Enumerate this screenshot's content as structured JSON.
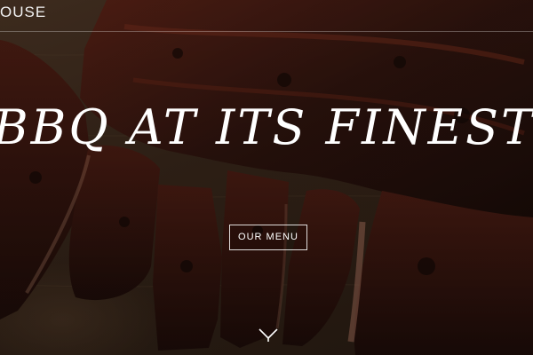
{
  "brand": {
    "name_fragment": "OUSE"
  },
  "hero": {
    "headline": "BBQ AT ITS FINEST",
    "cta_label": "OUR MENU",
    "scroll_icon": "chevron-down-icon"
  },
  "colors": {
    "text": "#ffffff",
    "wood_background": "#3a281b",
    "meat_dark": "#2a120d",
    "meat_crust": "#5a2216"
  }
}
